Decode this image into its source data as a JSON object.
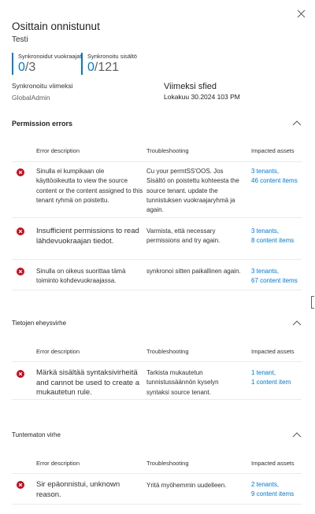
{
  "panel": {
    "title": "Osittain onnistunut",
    "subtitle": "Testi",
    "close_icon": "close-icon"
  },
  "stats": [
    {
      "label": "Synkronoidut vuokraajat",
      "value": "0",
      "total": "/3"
    },
    {
      "label": "Synkronoitu sisältö",
      "value": "0",
      "total": "/121"
    }
  ],
  "synced_by": {
    "label": "Synkronoitu viimeksi",
    "value": "GlobalAdmin"
  },
  "last_synced": {
    "label": "Viimeksi sfied",
    "value": "Lokakuu 30.2024 103 PM"
  },
  "table_headers": {
    "description": "Error description",
    "troubleshooting": "Troubleshooting",
    "impacted": "Impacted assets"
  },
  "sections": [
    {
      "title": "Permission errors",
      "rows": [
        {
          "description": "Sinulla ei kumpikaan ole käyttöoikeutta to view the source content or the content assigned to this tenant ryhmä on poistettu.",
          "troubleshooting": "Cu your permtSS'OOS. Jos Sisältö on poistettu kohteesta the source tenant. update the tunnistuksen vuokraajaryhmä ja again.",
          "tenants": "3 tenants,",
          "items": "46 content items"
        },
        {
          "description": "Insufficient permissions to read lähdevuokraajan tiedot.",
          "troubleshooting": "Varmista, että necessary permissions and try again.",
          "tenants": "3 tenants,",
          "items": "8 content items"
        },
        {
          "description": "Sinulla on oikeus suorittaa tämä toiminto kohdevuokraajassa.",
          "troubleshooting": "synkronoi sitten paikallinen again.",
          "tenants": "3 tenants,",
          "items": "67 content items"
        }
      ]
    },
    {
      "title": "Tietojen eheysvirhe",
      "rows": [
        {
          "description": "Märkä sisältää syntaksivirheitä and cannot be used to create a mukautetun rule.",
          "troubleshooting": "Tarkista mukautetun tunnistussäännön kyselyn syntaksi source tenant.",
          "tenants": "1 tenant,",
          "items": "1 content item"
        }
      ]
    },
    {
      "title": "Tuntematon virhe",
      "rows": [
        {
          "description": "Sir epäonnistui, unknown reason.",
          "troubleshooting": "Yritä myöhemmin uudelleen.",
          "tenants": "2 tenants,",
          "items": "9 content items"
        }
      ]
    }
  ],
  "colors": {
    "accent": "#0078d4",
    "error": "#c50f1f",
    "divider": "#edebe9"
  },
  "icons": {
    "error": "error-circle-icon",
    "collapse": "chevron-up-icon"
  }
}
